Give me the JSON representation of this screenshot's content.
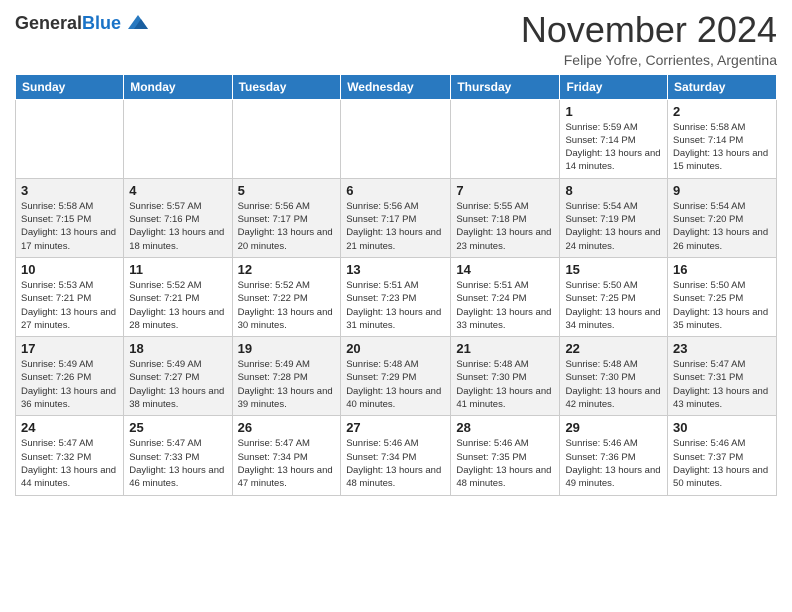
{
  "header": {
    "logo_line1": "General",
    "logo_line2": "Blue",
    "month_title": "November 2024",
    "subtitle": "Felipe Yofre, Corrientes, Argentina"
  },
  "weekdays": [
    "Sunday",
    "Monday",
    "Tuesday",
    "Wednesday",
    "Thursday",
    "Friday",
    "Saturday"
  ],
  "weeks": [
    [
      {
        "day": "",
        "info": ""
      },
      {
        "day": "",
        "info": ""
      },
      {
        "day": "",
        "info": ""
      },
      {
        "day": "",
        "info": ""
      },
      {
        "day": "",
        "info": ""
      },
      {
        "day": "1",
        "info": "Sunrise: 5:59 AM\nSunset: 7:14 PM\nDaylight: 13 hours and 14 minutes."
      },
      {
        "day": "2",
        "info": "Sunrise: 5:58 AM\nSunset: 7:14 PM\nDaylight: 13 hours and 15 minutes."
      }
    ],
    [
      {
        "day": "3",
        "info": "Sunrise: 5:58 AM\nSunset: 7:15 PM\nDaylight: 13 hours and 17 minutes."
      },
      {
        "day": "4",
        "info": "Sunrise: 5:57 AM\nSunset: 7:16 PM\nDaylight: 13 hours and 18 minutes."
      },
      {
        "day": "5",
        "info": "Sunrise: 5:56 AM\nSunset: 7:17 PM\nDaylight: 13 hours and 20 minutes."
      },
      {
        "day": "6",
        "info": "Sunrise: 5:56 AM\nSunset: 7:17 PM\nDaylight: 13 hours and 21 minutes."
      },
      {
        "day": "7",
        "info": "Sunrise: 5:55 AM\nSunset: 7:18 PM\nDaylight: 13 hours and 23 minutes."
      },
      {
        "day": "8",
        "info": "Sunrise: 5:54 AM\nSunset: 7:19 PM\nDaylight: 13 hours and 24 minutes."
      },
      {
        "day": "9",
        "info": "Sunrise: 5:54 AM\nSunset: 7:20 PM\nDaylight: 13 hours and 26 minutes."
      }
    ],
    [
      {
        "day": "10",
        "info": "Sunrise: 5:53 AM\nSunset: 7:21 PM\nDaylight: 13 hours and 27 minutes."
      },
      {
        "day": "11",
        "info": "Sunrise: 5:52 AM\nSunset: 7:21 PM\nDaylight: 13 hours and 28 minutes."
      },
      {
        "day": "12",
        "info": "Sunrise: 5:52 AM\nSunset: 7:22 PM\nDaylight: 13 hours and 30 minutes."
      },
      {
        "day": "13",
        "info": "Sunrise: 5:51 AM\nSunset: 7:23 PM\nDaylight: 13 hours and 31 minutes."
      },
      {
        "day": "14",
        "info": "Sunrise: 5:51 AM\nSunset: 7:24 PM\nDaylight: 13 hours and 33 minutes."
      },
      {
        "day": "15",
        "info": "Sunrise: 5:50 AM\nSunset: 7:25 PM\nDaylight: 13 hours and 34 minutes."
      },
      {
        "day": "16",
        "info": "Sunrise: 5:50 AM\nSunset: 7:25 PM\nDaylight: 13 hours and 35 minutes."
      }
    ],
    [
      {
        "day": "17",
        "info": "Sunrise: 5:49 AM\nSunset: 7:26 PM\nDaylight: 13 hours and 36 minutes."
      },
      {
        "day": "18",
        "info": "Sunrise: 5:49 AM\nSunset: 7:27 PM\nDaylight: 13 hours and 38 minutes."
      },
      {
        "day": "19",
        "info": "Sunrise: 5:49 AM\nSunset: 7:28 PM\nDaylight: 13 hours and 39 minutes."
      },
      {
        "day": "20",
        "info": "Sunrise: 5:48 AM\nSunset: 7:29 PM\nDaylight: 13 hours and 40 minutes."
      },
      {
        "day": "21",
        "info": "Sunrise: 5:48 AM\nSunset: 7:30 PM\nDaylight: 13 hours and 41 minutes."
      },
      {
        "day": "22",
        "info": "Sunrise: 5:48 AM\nSunset: 7:30 PM\nDaylight: 13 hours and 42 minutes."
      },
      {
        "day": "23",
        "info": "Sunrise: 5:47 AM\nSunset: 7:31 PM\nDaylight: 13 hours and 43 minutes."
      }
    ],
    [
      {
        "day": "24",
        "info": "Sunrise: 5:47 AM\nSunset: 7:32 PM\nDaylight: 13 hours and 44 minutes."
      },
      {
        "day": "25",
        "info": "Sunrise: 5:47 AM\nSunset: 7:33 PM\nDaylight: 13 hours and 46 minutes."
      },
      {
        "day": "26",
        "info": "Sunrise: 5:47 AM\nSunset: 7:34 PM\nDaylight: 13 hours and 47 minutes."
      },
      {
        "day": "27",
        "info": "Sunrise: 5:46 AM\nSunset: 7:34 PM\nDaylight: 13 hours and 48 minutes."
      },
      {
        "day": "28",
        "info": "Sunrise: 5:46 AM\nSunset: 7:35 PM\nDaylight: 13 hours and 48 minutes."
      },
      {
        "day": "29",
        "info": "Sunrise: 5:46 AM\nSunset: 7:36 PM\nDaylight: 13 hours and 49 minutes."
      },
      {
        "day": "30",
        "info": "Sunrise: 5:46 AM\nSunset: 7:37 PM\nDaylight: 13 hours and 50 minutes."
      }
    ]
  ]
}
